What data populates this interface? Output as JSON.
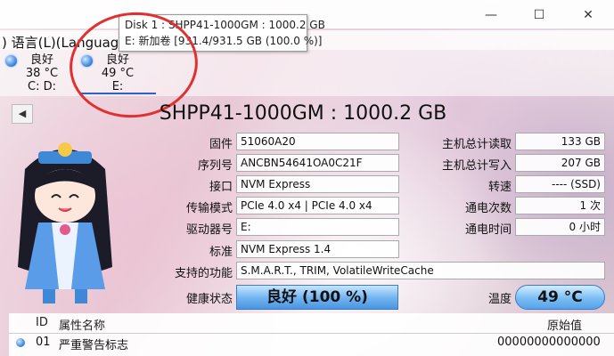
{
  "window": {
    "minimize_icon": "minimize-icon",
    "maximize_icon": "maximize-icon",
    "close_icon": "close-icon"
  },
  "menu": {
    "visible_text": ") 语言(L)(Language"
  },
  "tooltip": {
    "line1": "Disk 1 : SHPP41-1000GM : 1000.2 GB",
    "line2": "E: 新加卷 [931.4/931.5 GB (100.0 %)]"
  },
  "disks": [
    {
      "status": "良好",
      "temp": "38 °C",
      "letters": "C: D:"
    },
    {
      "status": "良好",
      "temp": "49 °C",
      "letters": "E:"
    }
  ],
  "model_title": "SHPP41-1000GM : 1000.2 GB",
  "left_fields": [
    {
      "label": "固件",
      "value": "51060A20"
    },
    {
      "label": "序列号",
      "value": "ANCBN54641OA0C21F"
    },
    {
      "label": "接口",
      "value": "NVM Express"
    },
    {
      "label": "传输模式",
      "value": "PCIe 4.0 x4 | PCIe 4.0 x4"
    },
    {
      "label": "驱动器号",
      "value": "E:"
    },
    {
      "label": "标准",
      "value": "NVM Express 1.4"
    },
    {
      "label": "支持的功能",
      "value": "S.M.A.R.T., TRIM, VolatileWriteCache"
    }
  ],
  "right_fields": [
    {
      "label": "主机总计读取",
      "value": "133 GB"
    },
    {
      "label": "主机总计写入",
      "value": "207 GB"
    },
    {
      "label": "转速",
      "value": "---- (SSD)"
    },
    {
      "label": "通电次数",
      "value": "1 次"
    },
    {
      "label": "通电时间",
      "value": "0 小时"
    }
  ],
  "health": {
    "label": "健康状态",
    "value": "良好  (100 %)"
  },
  "temperature": {
    "label": "温度",
    "value": "49 °C"
  },
  "table": {
    "headers": {
      "id": "ID",
      "name": "属性名称",
      "raw": "原始值"
    },
    "rows": [
      {
        "id": "01",
        "name": "严重警告标志",
        "raw": "00000000000000"
      }
    ]
  },
  "colors": {
    "health_blue": "#6fb2f0",
    "annotation_red": "#e03030",
    "selected_underline": "#2d5fd0"
  }
}
